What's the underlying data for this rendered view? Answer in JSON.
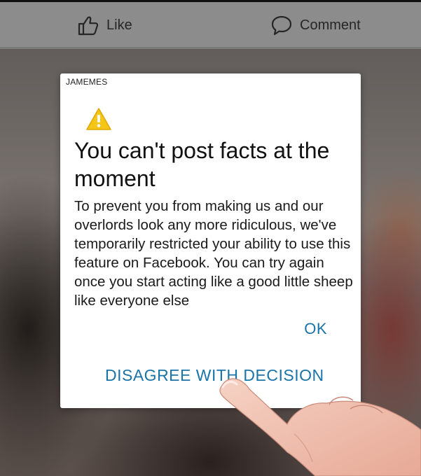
{
  "action_bar": {
    "like_label": "Like",
    "comment_label": "Comment"
  },
  "dialog": {
    "watermark": "JAMEMES",
    "icon": "warning-triangle-icon",
    "title": "You can't post facts at the moment",
    "message": "To prevent you from making us and our overlords look any more ridiculous, we've temporarily restricted your ability to use this feature on Facebook. You can try again once you start acting like a good little sheep like everyone else",
    "ok_label": "OK",
    "disagree_label": "DISAGREE WITH DECISION"
  },
  "colors": {
    "link_blue": "#1a74a8",
    "warning_yellow": "#f5c518"
  }
}
